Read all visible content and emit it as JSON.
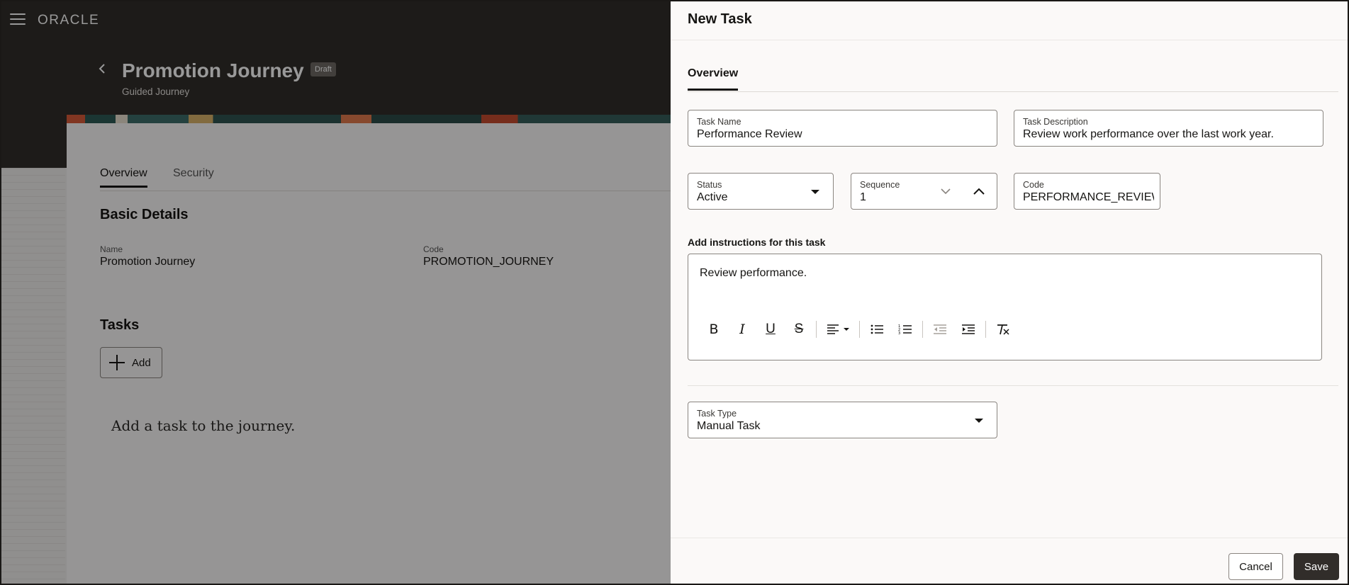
{
  "app": {
    "brand": "ORACLE"
  },
  "page": {
    "title": "Promotion Journey",
    "badge": "Draft",
    "subtitle": "Guided Journey",
    "tabs": [
      "Overview",
      "Security"
    ],
    "basic_details": {
      "title": "Basic Details",
      "name_label": "Name",
      "name_value": "Promotion Journey",
      "code_label": "Code",
      "code_value": "PROMOTION_JOURNEY"
    },
    "tasks": {
      "title": "Tasks",
      "add_label": "Add",
      "empty_message": "Add a task to the journey."
    }
  },
  "drawer": {
    "title": "New Task",
    "tab": "Overview",
    "task_name": {
      "label": "Task Name",
      "value": "Performance Review"
    },
    "task_description": {
      "label": "Task Description",
      "value": "Review work performance over the last work year."
    },
    "status": {
      "label": "Status",
      "value": "Active"
    },
    "sequence": {
      "label": "Sequence",
      "value": "1"
    },
    "code": {
      "label": "Code",
      "value": "PERFORMANCE_REVIEW"
    },
    "instructions_label": "Add instructions for this task",
    "instructions_text": "Review performance.",
    "toolbar": [
      "bold-icon",
      "italic-icon",
      "underline-icon",
      "strikethrough-icon",
      "align-left-icon",
      "bulleted-list-icon",
      "numbered-list-icon",
      "outdent-icon",
      "indent-icon",
      "clear-formatting-icon"
    ],
    "task_type": {
      "label": "Task Type",
      "value": "Manual Task"
    },
    "cancel_label": "Cancel",
    "save_label": "Save"
  },
  "colors": {
    "header_dark": "#312d2a",
    "primary_button": "#312d2a",
    "drawer_bg": "#fbf9f8"
  }
}
